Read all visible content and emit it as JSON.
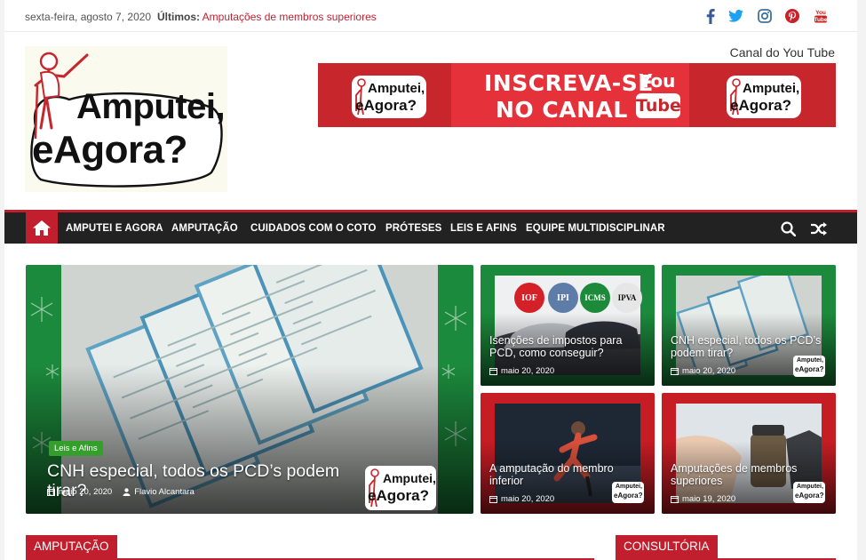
{
  "topbar": {
    "date": "sexta-feira, agosto 7, 2020",
    "latest_label": "Últimos:",
    "latest_link": "Amputações de membros superiores",
    "social": [
      "facebook-icon",
      "twitter-icon",
      "instagram-icon",
      "pinterest-icon",
      "youtube-icon"
    ],
    "youtube_icon_text": "You Tube"
  },
  "header": {
    "logo_line1": "Amputei,",
    "logo_line2": "eAgora?",
    "channel_label": "Canal do You Tube",
    "banner": {
      "line1": "INSCREVA-SE",
      "line2": "NO CANAL",
      "yt_top": "You",
      "yt_bottom": "Tube",
      "mini_logo_1": "Amputei,",
      "mini_logo_2": "eAgora?"
    }
  },
  "nav": {
    "items": [
      "AMPUTEI E AGORA",
      "AMPUTAÇÃO",
      "CUIDADOS COM O COTO",
      "PRÓTESES",
      "LEIS E AFINS",
      "EQUIPE MULTIDISCIPLINAR"
    ]
  },
  "featured": {
    "main": {
      "badge": "Leis e Afins",
      "title": "CNH especial, todos os PCD’s podem tirar?",
      "date": "maio 20, 2020",
      "author": "Flavio Alcantara",
      "wm1": "Amputei,",
      "wm2": "eAgora?"
    },
    "cards": [
      {
        "title": "Isenções de impostos para PCD, como conseguir?",
        "date": "maio 20, 2020",
        "tags": [
          "IOF",
          "IPI",
          "ICMS",
          "IPVA"
        ]
      },
      {
        "title": "CNH especial, todos os PCD’s podem tirar?",
        "date": "maio 20, 2020"
      },
      {
        "title": "A amputação do membro inferior",
        "date": "maio 20, 2020"
      },
      {
        "title": "Amputações de membros superiores",
        "date": "maio 19, 2020"
      }
    ],
    "wm_small_1": "Amputei,",
    "wm_small_2": "eAgora?"
  },
  "sections": {
    "left": "AMPUTAÇÃO",
    "right": "CONSULTÓRIA"
  },
  "colors": {
    "accent": "#c11f2e",
    "nav_bg": "#222222",
    "badge_green": "#34a02b",
    "xmas_green": "#1c8a3c",
    "xmas_red": "#c61d24"
  }
}
